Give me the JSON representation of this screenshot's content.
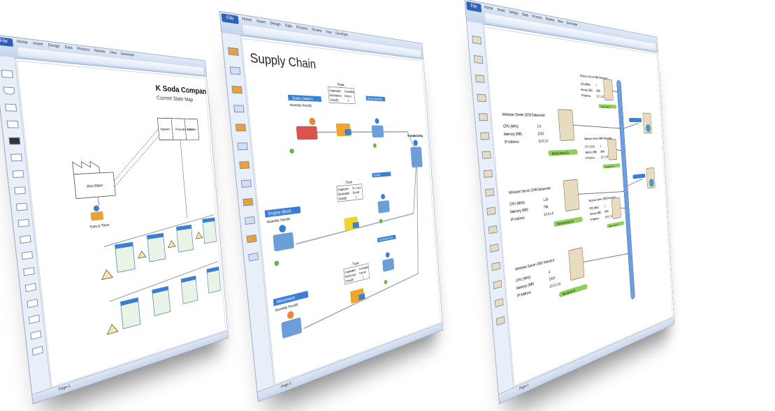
{
  "ribbon": {
    "file_label": "File",
    "tabs": [
      "Home",
      "Insert",
      "Design",
      "Data",
      "Process",
      "Review",
      "View",
      "Developer"
    ]
  },
  "win1": {
    "title": "K Soda Company",
    "subtitle": "Current State Map",
    "boxes": [
      "Production Control",
      "Customer",
      "Suppliers"
    ],
    "supplier_label": "Alco Glass",
    "truck_label": "Tues & Thurs",
    "page_tab": "Page-1"
  },
  "win2": {
    "title": "Supply Chain",
    "stages": [
      "Brake Calipers",
      "Engine Block",
      "Movement",
      "Brake Assembly",
      "Engine",
      "Assembly Plant",
      "Manufacturing"
    ],
    "trucks": [
      {
        "title": "Truck",
        "rows": [
          [
            "Origination",
            "Cleveland"
          ],
          [
            "Destination",
            "Detroit"
          ],
          [
            "Time(D)",
            "1"
          ]
        ]
      },
      {
        "title": "Truck",
        "rows": [
          [
            "Origination",
            "St. Louis"
          ],
          [
            "Destination",
            "Detroit"
          ],
          [
            "Time(D)",
            "1"
          ]
        ]
      },
      {
        "title": "Truck",
        "rows": [
          [
            "Origination",
            "Lexington"
          ],
          [
            "Destination",
            "Detroit"
          ],
          [
            "Time(D)",
            "1"
          ]
        ]
      }
    ],
    "stage_field": "Assembly Time(M)",
    "page_tab": "Page-1"
  },
  "win3": {
    "servers": [
      {
        "title": "Windows Server 2008 Datacenter",
        "rows": [
          [
            "CPU (MHz)",
            "1.6"
          ],
          [
            "Memory (MB)",
            "1024"
          ],
          [
            "IP Address",
            "10.0.1.5"
          ]
        ],
        "tag": "Backup server (1)"
      },
      {
        "title": "Windows Server 2008 Datacenter",
        "rows": [
          [
            "CPU (MHz)",
            "1.26"
          ],
          [
            "Memory (MB)",
            "768"
          ],
          [
            "IP Address",
            "10.0.1.6"
          ]
        ],
        "tag": "Backup server (2)"
      },
      {
        "title": "Windows Server 2008 Standard",
        "rows": [
          [
            "CPU (MHz)",
            "4"
          ],
          [
            "Memory (MB)",
            "1024"
          ],
          [
            "IP Address",
            "10.0.1.14"
          ]
        ],
        "tag": "App server (1)"
      },
      {
        "title": "Windows Server 2008 Datacenter",
        "rows": [
          [
            "CPU (MHz)",
            "1"
          ],
          [
            "Memory (MB)",
            "2048"
          ],
          [
            "IP Address",
            "10.0.1.11"
          ]
        ],
        "tag": "Web server (1)"
      },
      {
        "title": "Windows Server 2008 Datacenter",
        "rows": [
          [
            "CPU (MHz)",
            "1"
          ],
          [
            "Memory (MB)",
            "2048"
          ],
          [
            "IP Address",
            "10.0.1.12"
          ]
        ],
        "tag": "Web server (2)"
      },
      {
        "title": "Windows Server 2008 Datacenter",
        "rows": [
          [
            "CPU (MHz)",
            "1"
          ],
          [
            "Memory (MB)",
            "2048"
          ],
          [
            "IP Address",
            "10.0.1.13"
          ]
        ],
        "tag": "Web server (3)"
      }
    ],
    "page_tab": "Page-1"
  },
  "colors": {
    "accent": "#2b62b8",
    "stage_header": "#3a7fd6",
    "server_tag": "#8fd05a",
    "bus": "#6d9fe0"
  }
}
